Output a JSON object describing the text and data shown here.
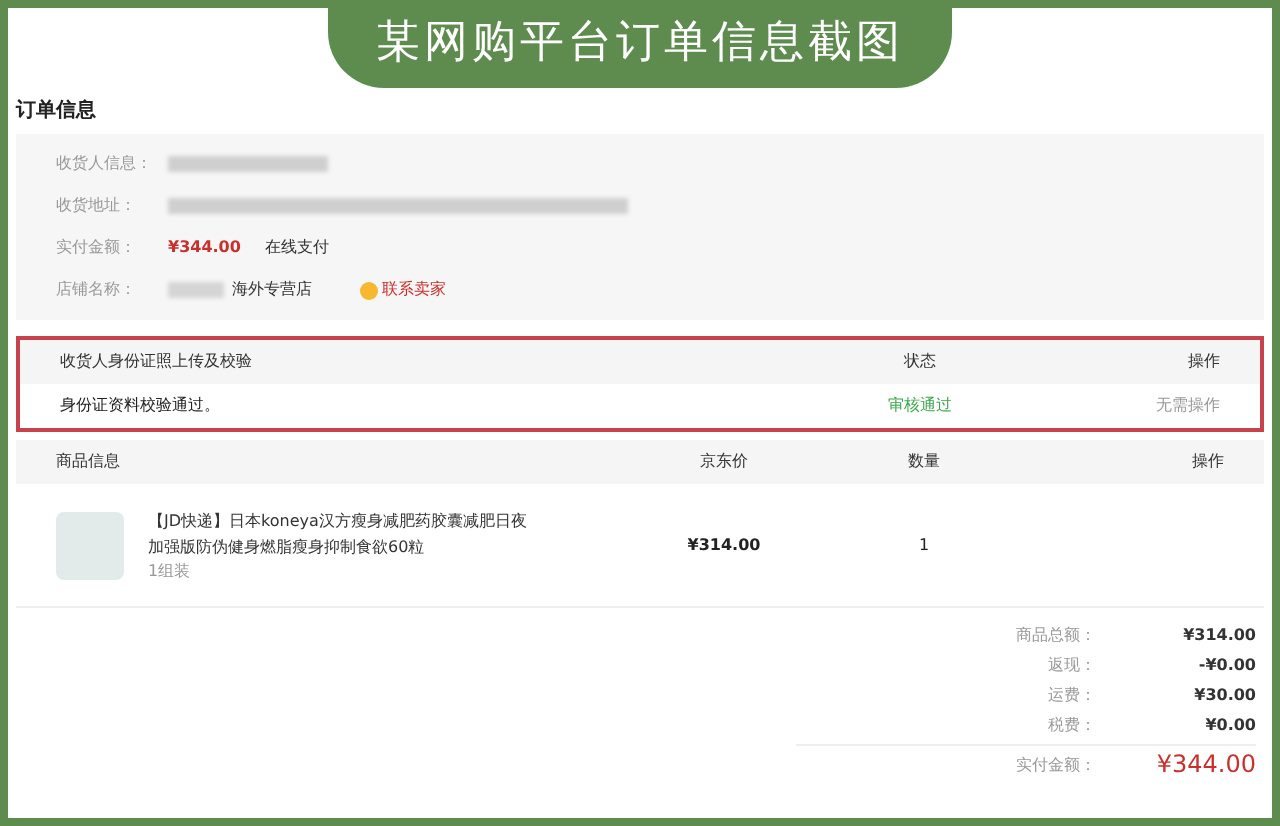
{
  "banner": {
    "title": "某网购平台订单信息截图"
  },
  "section_title": "订单信息",
  "info": [
    {
      "label": "收货人信息：",
      "kind": "consignee"
    },
    {
      "label": "收货地址：",
      "kind": "address"
    },
    {
      "label": "实付金额：",
      "kind": "amount",
      "value": "¥344.00",
      "extra": "在线支付"
    },
    {
      "label": "店铺名称：",
      "kind": "shop",
      "value": "海外专营店",
      "link": "联系卖家"
    }
  ],
  "id_check": {
    "columns": [
      "收货人身份证照上传及校验",
      "状态",
      "操作"
    ],
    "row": {
      "message": "身份证资料校验通过。",
      "status": "审核通过",
      "action": "无需操作"
    }
  },
  "products": {
    "columns": [
      "商品信息",
      "京东价",
      "数量",
      "操作"
    ],
    "rows": [
      {
        "title": "【JD快递】日本koneya汉方瘦身减肥药胶囊减肥日夜加强版防伪健身燃脂瘦身抑制食欲60粒",
        "spec": "1组装",
        "price": "¥314.00",
        "quantity": "1"
      }
    ]
  },
  "totals": [
    {
      "label": "商品总额：",
      "value": "¥314.00"
    },
    {
      "label": "返现：",
      "value": "-¥0.00"
    },
    {
      "label": "运费：",
      "value": "¥30.00"
    },
    {
      "label": "税费：",
      "value": "¥0.00"
    }
  ],
  "paid": {
    "label": "实付金额：",
    "value": "¥344.00"
  }
}
